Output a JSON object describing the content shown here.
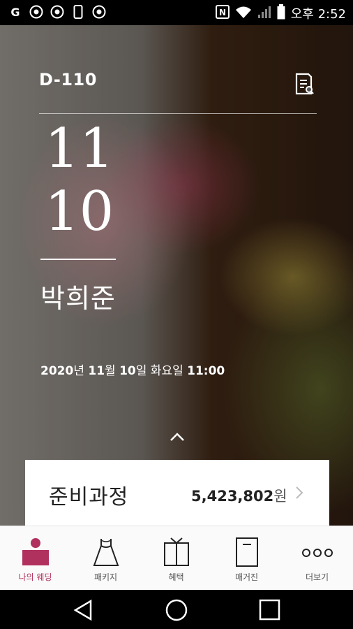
{
  "status_bar": {
    "left_icons": [
      "google-icon",
      "cast-icon",
      "cast-icon",
      "phone-icon",
      "cast-icon"
    ],
    "right_icons": [
      "nfc-icon",
      "wifi-icon",
      "signal-icon",
      "battery-icon"
    ],
    "time": "오후 2:52"
  },
  "hero": {
    "dday": "D-110",
    "month": "11",
    "day": "10",
    "name": "박희준",
    "date_year": "2020",
    "date_year_unit": "년 ",
    "date_month": "11",
    "date_month_unit": "월 ",
    "date_day": "10",
    "date_day_unit": "일 화요일 ",
    "date_time": "11:00"
  },
  "card": {
    "title": "준비과정",
    "amount": "5,423,802",
    "unit": "원"
  },
  "bottom_nav": {
    "items": [
      {
        "label": "나의 웨딩",
        "icon": "person-icon",
        "active": true
      },
      {
        "label": "패키지",
        "icon": "dress-icon",
        "active": false
      },
      {
        "label": "혜택",
        "icon": "gift-icon",
        "active": false
      },
      {
        "label": "매거진",
        "icon": "magazine-icon",
        "active": false
      },
      {
        "label": "더보기",
        "icon": "more-icon",
        "active": false
      }
    ]
  },
  "colors": {
    "accent": "#b0305e",
    "nav_inactive": "#555555"
  }
}
